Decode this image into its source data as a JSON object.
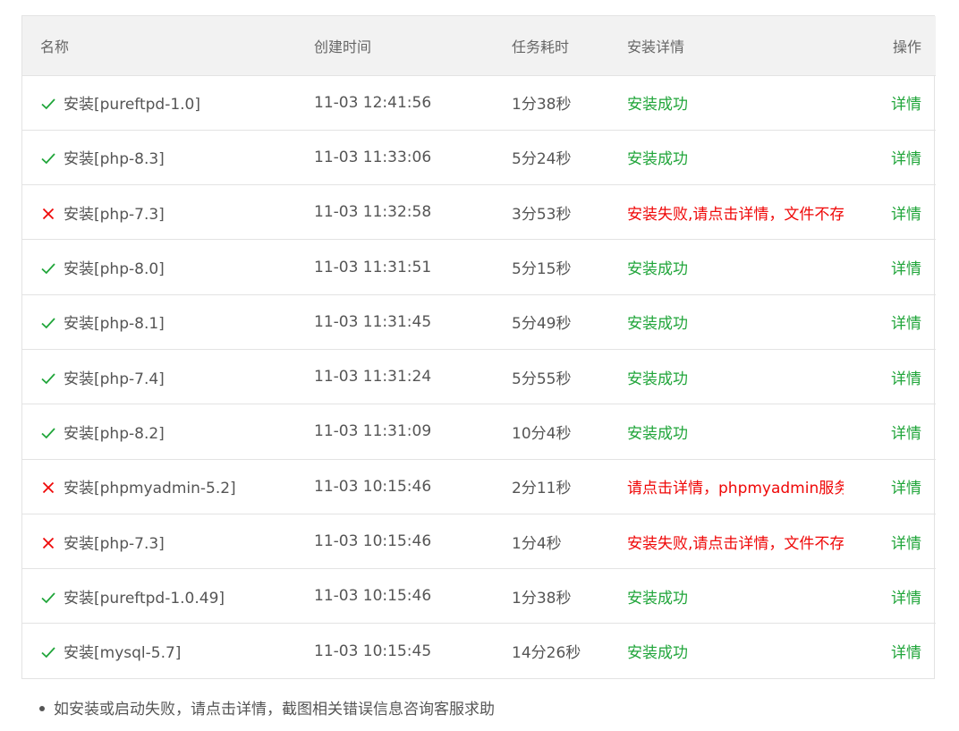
{
  "table": {
    "headers": {
      "name": "名称",
      "created": "创建时间",
      "duration": "任务耗时",
      "detail": "安装详情",
      "action": "操作"
    },
    "rows": [
      {
        "status": "success",
        "name": "安装[pureftpd-1.0]",
        "created": "11-03 12:41:56",
        "duration": "1分38秒",
        "detail": "安装成功",
        "action": "详情"
      },
      {
        "status": "success",
        "name": "安装[php-8.3]",
        "created": "11-03 11:33:06",
        "duration": "5分24秒",
        "detail": "安装成功",
        "action": "详情"
      },
      {
        "status": "fail",
        "name": "安装[php-7.3]",
        "created": "11-03 11:32:58",
        "duration": "3分53秒",
        "detail": "安装失败,请点击详情，文件不存",
        "action": "详情"
      },
      {
        "status": "success",
        "name": "安装[php-8.0]",
        "created": "11-03 11:31:51",
        "duration": "5分15秒",
        "detail": "安装成功",
        "action": "详情"
      },
      {
        "status": "success",
        "name": "安装[php-8.1]",
        "created": "11-03 11:31:45",
        "duration": "5分49秒",
        "detail": "安装成功",
        "action": "详情"
      },
      {
        "status": "success",
        "name": "安装[php-7.4]",
        "created": "11-03 11:31:24",
        "duration": "5分55秒",
        "detail": "安装成功",
        "action": "详情"
      },
      {
        "status": "success",
        "name": "安装[php-8.2]",
        "created": "11-03 11:31:09",
        "duration": "10分4秒",
        "detail": "安装成功",
        "action": "详情"
      },
      {
        "status": "fail",
        "name": "安装[phpmyadmin-5.2]",
        "created": "11-03 10:15:46",
        "duration": "2分11秒",
        "detail": "请点击详情，phpmyadmin服务",
        "action": "详情"
      },
      {
        "status": "fail",
        "name": "安装[php-7.3]",
        "created": "11-03 10:15:46",
        "duration": "1分4秒",
        "detail": "安装失败,请点击详情，文件不存",
        "action": "详情"
      },
      {
        "status": "success",
        "name": "安装[pureftpd-1.0.49]",
        "created": "11-03 10:15:46",
        "duration": "1分38秒",
        "detail": "安装成功",
        "action": "详情"
      },
      {
        "status": "success",
        "name": "安装[mysql-5.7]",
        "created": "11-03 10:15:45",
        "duration": "14分26秒",
        "detail": "安装成功",
        "action": "详情"
      }
    ]
  },
  "note": "如安装或启动失败，请点击详情，截图相关错误信息咨询客服求助",
  "colors": {
    "success": "#20a53a",
    "fail": "#ef0808",
    "link": "#20a53a"
  },
  "icons": {
    "success": "check-icon",
    "fail": "close-icon"
  }
}
